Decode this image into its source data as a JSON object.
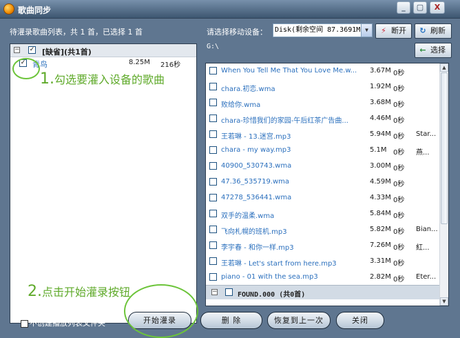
{
  "window": {
    "title": "歌曲同步",
    "minimize_label": "_",
    "restore_label": "▢",
    "close_label": "X"
  },
  "status": "待灌录歌曲列表，共 1 首，已选择 1 首",
  "device": {
    "label": "请选择移动设备：",
    "selected": "Disk(剩余空间 87.3691M"
  },
  "toolbar": {
    "disconnect_label": "断开",
    "refresh_label": "刷新",
    "select_label": "选择"
  },
  "path": "G:\\",
  "left_panel": {
    "group_label": "[缺省](共1首)",
    "songs": [
      {
        "name": "青鸟",
        "size": "8.25M",
        "duration": "216秒",
        "checked": true
      }
    ]
  },
  "right_panel": {
    "songs": [
      {
        "name": "When You Tell Me That You Love Me.w...",
        "size": "3.67M",
        "duration": "0秒",
        "extra": ""
      },
      {
        "name": "chara.初恋.wma",
        "size": "1.92M",
        "duration": "0秒",
        "extra": ""
      },
      {
        "name": "败给你.wma",
        "size": "3.68M",
        "duration": "0秒",
        "extra": ""
      },
      {
        "name": "chara-珍惜我们的家园-午后红茶广告曲...",
        "size": "4.46M",
        "duration": "0秒",
        "extra": ""
      },
      {
        "name": "王若琳 - 13.迷宫.mp3",
        "size": "5.94M",
        "duration": "0秒",
        "extra": "Star..."
      },
      {
        "name": "chara - my way.mp3",
        "size": "5.1M",
        "duration": "0秒",
        "extra": "燕..."
      },
      {
        "name": "40900_530743.wma",
        "size": "3.00M",
        "duration": "0秒",
        "extra": ""
      },
      {
        "name": "47.36_535719.wma",
        "size": "4.59M",
        "duration": "0秒",
        "extra": ""
      },
      {
        "name": "47278_536441.wma",
        "size": "4.33M",
        "duration": "0秒",
        "extra": ""
      },
      {
        "name": "双手的温柔.wma",
        "size": "5.84M",
        "duration": "0秒",
        "extra": ""
      },
      {
        "name": "飞向札幌的班机.mp3",
        "size": "5.82M",
        "duration": "0秒",
        "extra": "Bian..."
      },
      {
        "name": "李宇春 - 和你一样.mp3",
        "size": "7.26M",
        "duration": "0秒",
        "extra": "紅..."
      },
      {
        "name": "王若琳 - Let's start from here.mp3",
        "size": "3.31M",
        "duration": "0秒",
        "extra": ""
      },
      {
        "name": "piano - 01 with the sea.mp3",
        "size": "2.82M",
        "duration": "0秒",
        "extra": "Eter..."
      }
    ],
    "group_label": "FOUND.000 (共0首)"
  },
  "bottom": {
    "no_playlist_label": "不创建播放列表文件夹",
    "start_label": "开始灌录",
    "delete_label": "删 除",
    "restore_label": "恢复到上一次",
    "close_label": "关闭"
  },
  "annotations": {
    "step1_num": "1.",
    "step1_text": "勾选要灌入设备的歌曲",
    "step2_num": "2.",
    "step2_text": "点击开始灌录按钮"
  },
  "colors": {
    "accent_link": "#2a6fbd",
    "annotation": "#5faa2a"
  }
}
